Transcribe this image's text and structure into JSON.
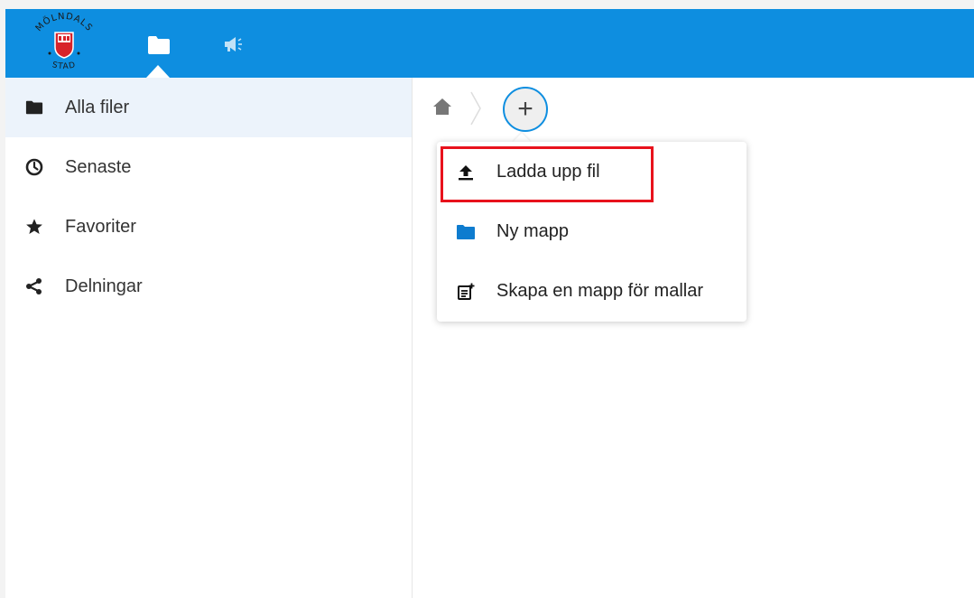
{
  "brand": {
    "logo_text_top": "MÖLNDALS",
    "logo_text_bottom": "STAD"
  },
  "header": {
    "nav": [
      {
        "icon": "folder-icon"
      },
      {
        "icon": "megaphone-icon"
      }
    ]
  },
  "sidebar": {
    "items": [
      {
        "label": "Alla filer",
        "icon": "folder-icon",
        "active": true
      },
      {
        "label": "Senaste",
        "icon": "clock-icon"
      },
      {
        "label": "Favoriter",
        "icon": "star-icon"
      },
      {
        "label": "Delningar",
        "icon": "share-icon"
      }
    ]
  },
  "toolbar": {
    "add_label": "+"
  },
  "new_menu": {
    "items": [
      {
        "label": "Ladda upp fil",
        "icon": "upload-icon",
        "highlighted": true
      },
      {
        "label": "Ny mapp",
        "icon": "folder-icon"
      },
      {
        "label": "Skapa en mapp för mallar",
        "icon": "template-icon"
      }
    ]
  },
  "colors": {
    "header": "#0e8ee0",
    "active_item": "#ecf3fb",
    "highlight": "#e8121c",
    "folder_blue": "#0e7ccf"
  }
}
